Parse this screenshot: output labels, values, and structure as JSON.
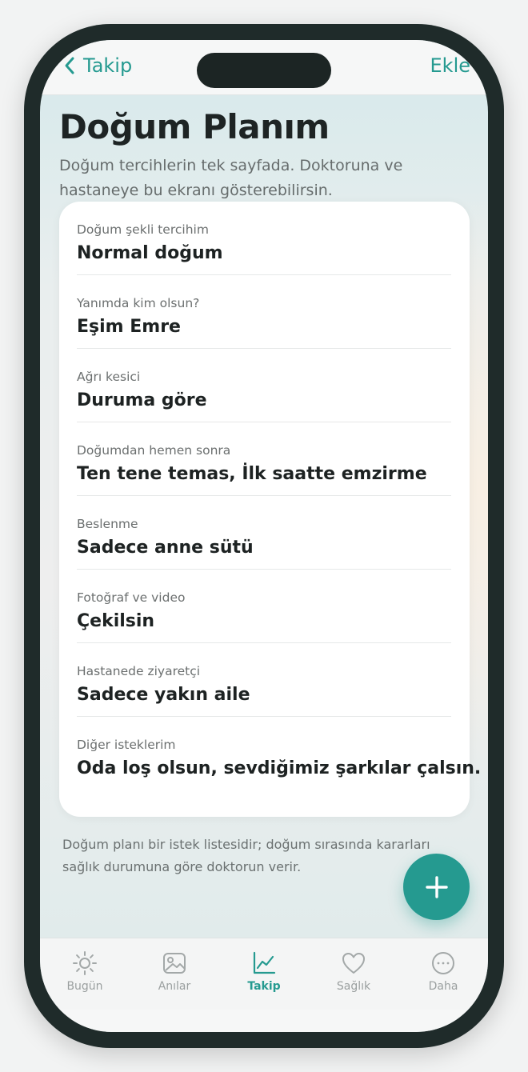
{
  "nav": {
    "back_label": "Takip",
    "action_label": "Ekle"
  },
  "page": {
    "title": "Doğum Planım",
    "subtitle": "Doğum tercihlerin tek sayfada. Doktoruna ve hastaneye bu ekranı gösterebilirsin."
  },
  "plan": {
    "items": [
      {
        "label": "Doğum şekli tercihim",
        "value": "Normal doğum"
      },
      {
        "label": "Yanımda kim olsun?",
        "value": "Eşim Emre"
      },
      {
        "label": "Ağrı kesici",
        "value": "Duruma göre"
      },
      {
        "label": "Doğumdan hemen sonra",
        "value": "Ten tene temas, İlk saatte emzirme"
      },
      {
        "label": "Beslenme",
        "value": "Sadece anne sütü"
      },
      {
        "label": "Fotoğraf ve video",
        "value": "Çekilsin"
      },
      {
        "label": "Hastanede ziyaretçi",
        "value": "Sadece yakın aile"
      },
      {
        "label": "Diğer isteklerim",
        "value": "Oda loş olsun, sevdiğimiz şarkılar çalsın."
      }
    ]
  },
  "note": "Doğum planı bir istek listesidir; doğum sırasında kararları sağlık durumuna göre doktorun verir.",
  "tabs": [
    {
      "label": "Bugün",
      "icon": "sun-icon"
    },
    {
      "label": "Anılar",
      "icon": "image-icon"
    },
    {
      "label": "Takip",
      "icon": "chart-line-icon",
      "active": true
    },
    {
      "label": "Sağlık",
      "icon": "heart-icon"
    },
    {
      "label": "Daha",
      "icon": "more-icon"
    }
  ],
  "colors": {
    "accent": "#259a90",
    "text": "#1e2424",
    "muted": "#6b6f6f"
  }
}
